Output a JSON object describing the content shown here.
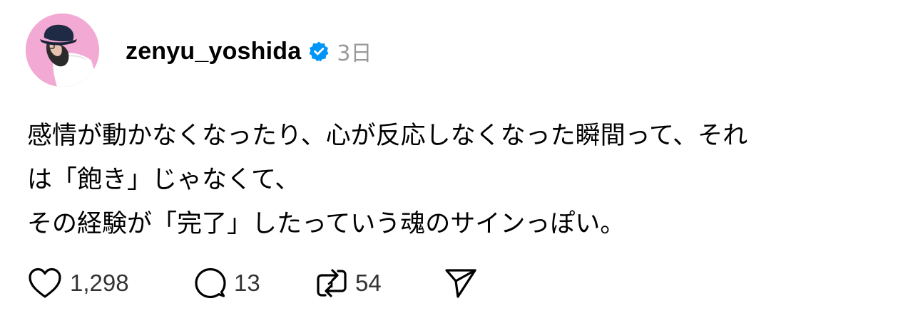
{
  "post": {
    "author": {
      "username": "zenyu_yoshida",
      "avatar_icon": "profile-photo",
      "verified_icon": "verified-badge-icon",
      "verified_color": "#0095f6"
    },
    "timestamp": "3日",
    "text_lines": [
      "感情が動かなくなったり、心が反応しなくなった瞬間って、それ",
      "は「飽き」じゃなくて、",
      "その経験が「完了」したっていう魂のサインっぽい。"
    ],
    "actions": {
      "like": {
        "icon": "heart-icon",
        "count": "1,298"
      },
      "reply": {
        "icon": "comment-icon",
        "count": "13"
      },
      "repost": {
        "icon": "repost-icon",
        "count": "54"
      },
      "share": {
        "icon": "send-icon"
      }
    },
    "colors": {
      "avatar_background": "#f2a9d3",
      "timestamp": "#999999",
      "count_text": "#333333"
    }
  }
}
